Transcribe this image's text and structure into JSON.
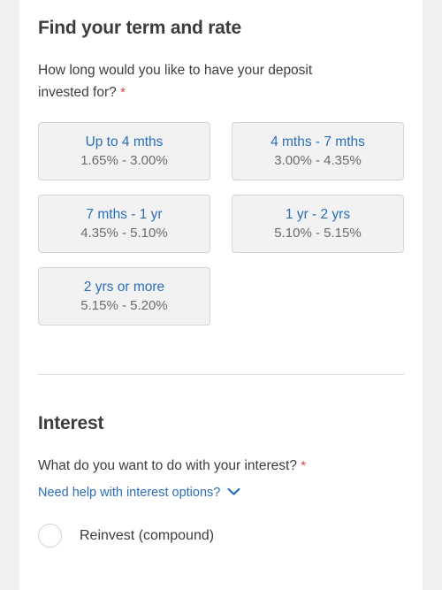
{
  "term_section": {
    "heading": "Find your term and rate",
    "question": "How long would you like to have your deposit invested for?",
    "required_marker": "*",
    "options": [
      {
        "term": "Up to 4 mths",
        "rate": "1.65% - 3.00%"
      },
      {
        "term": "4 mths - 7 mths",
        "rate": "3.00% - 4.35%"
      },
      {
        "term": "7 mths - 1 yr",
        "rate": "4.35% - 5.10%"
      },
      {
        "term": "1 yr - 2 yrs",
        "rate": "5.10% - 5.15%"
      },
      {
        "term": "2 yrs or more",
        "rate": "5.15% - 5.20%"
      }
    ]
  },
  "interest_section": {
    "heading": "Interest",
    "question": "What do you want to do with your interest?",
    "required_marker": "*",
    "help_link": "Need help with interest options?",
    "help_icon": "chevron-down-icon",
    "radio_options": [
      {
        "label": "Reinvest (compound)",
        "selected": false
      }
    ]
  },
  "colors": {
    "link_blue": "#2a6ebb",
    "text_dark": "#3c3c3b",
    "muted_gray": "#6b6b6b",
    "required_red": "#d0454c",
    "card_bg": "#f2f2f2",
    "card_border": "#d6d6d6",
    "page_bg": "#f0f0f0"
  }
}
